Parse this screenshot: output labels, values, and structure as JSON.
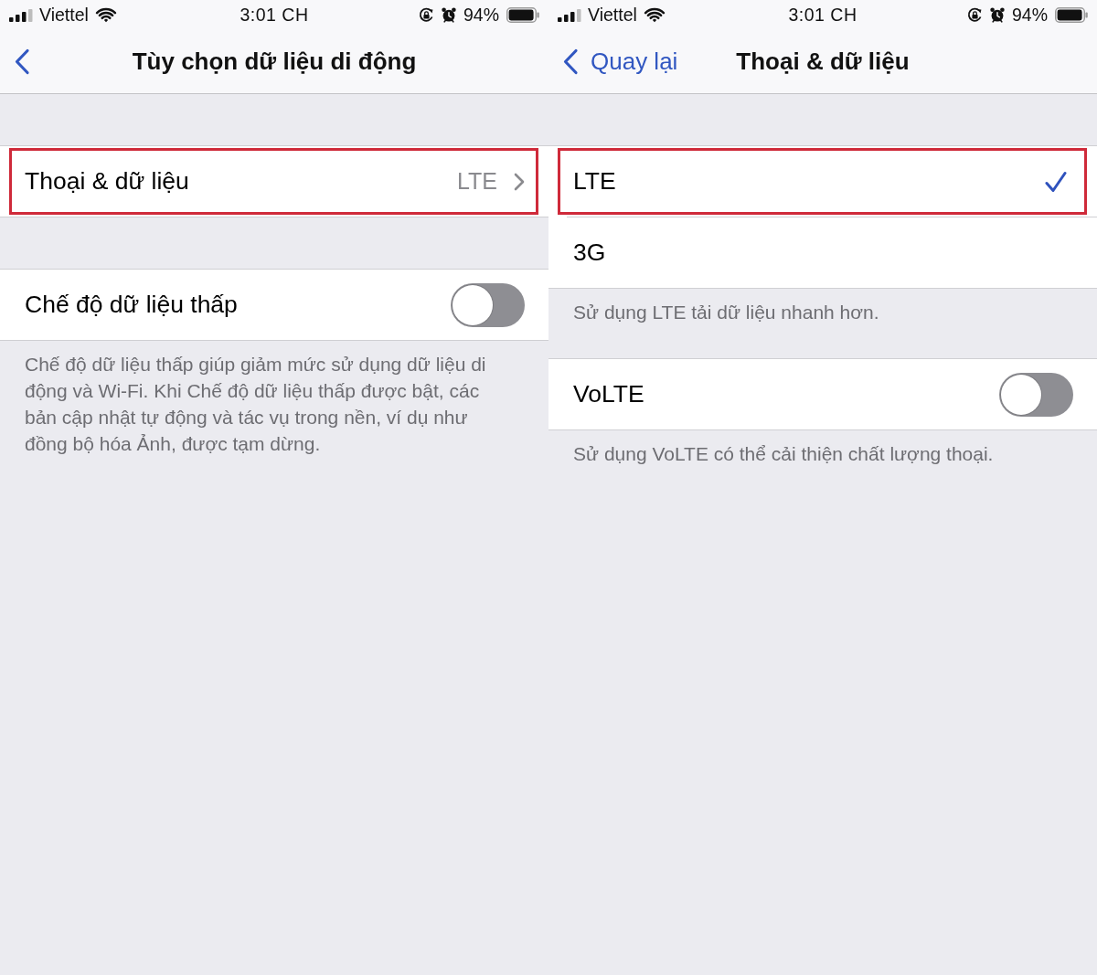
{
  "screens": [
    {
      "status_bar": {
        "carrier": "Viettel",
        "time": "3:01 CH",
        "battery": "94%"
      },
      "nav_bar": {
        "title": "Tùy chọn dữ liệu di động"
      },
      "groups": [
        {
          "rows": [
            {
              "kind": "link",
              "label": "Thoại & dữ liệu",
              "value": "LTE",
              "highlighted": true
            }
          ]
        },
        {
          "rows": [
            {
              "kind": "toggle",
              "label": "Chế độ dữ liệu thấp",
              "on": false,
              "highlighted": false
            }
          ],
          "footer": "Chế độ dữ liệu thấp giúp giảm mức sử dụng dữ liệu di động và Wi-Fi. Khi Chế độ dữ liệu thấp được bật, các bản cập nhật tự động và tác vụ trong nền, ví dụ như đồng bộ hóa Ảnh, được tạm dừng."
        }
      ]
    },
    {
      "status_bar": {
        "carrier": "Viettel",
        "time": "3:01 CH",
        "battery": "94%"
      },
      "nav_bar": {
        "back_label": "Quay lại",
        "title": "Thoại & dữ liệu"
      },
      "groups": [
        {
          "rows": [
            {
              "kind": "option",
              "label": "LTE",
              "selected": true,
              "highlighted": true
            },
            {
              "kind": "option",
              "label": "3G",
              "selected": false,
              "highlighted": false
            }
          ],
          "footer": "Sử dụng LTE tải dữ liệu nhanh hơn."
        },
        {
          "rows": [
            {
              "kind": "toggle",
              "label": "VoLTE",
              "on": false,
              "highlighted": false
            }
          ],
          "footer": "Sử dụng VoLTE có thể cải thiện chất lượng thoại."
        }
      ]
    }
  ]
}
